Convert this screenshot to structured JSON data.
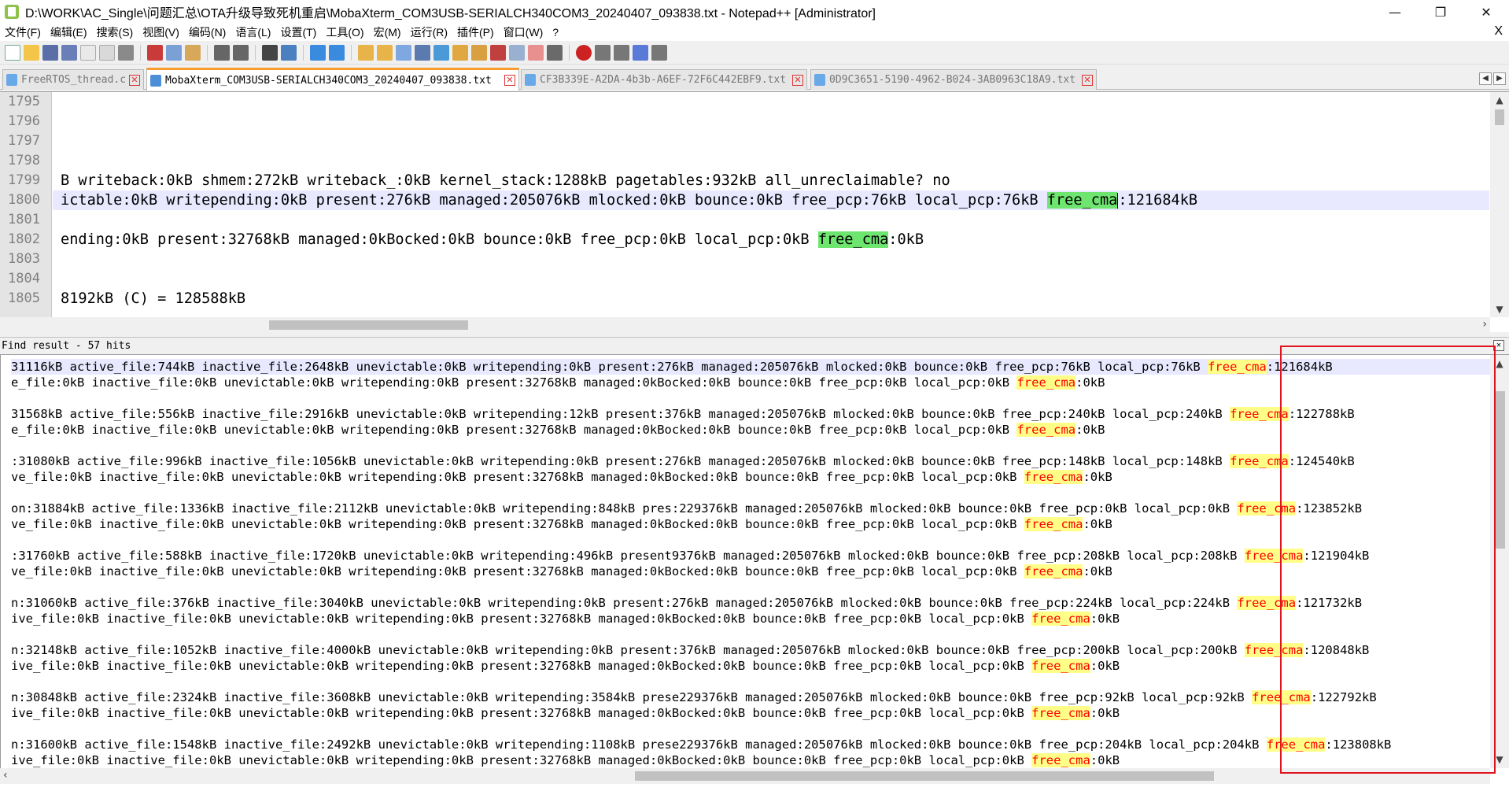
{
  "window": {
    "title": "D:\\WORK\\AC_Single\\问题汇总\\OTA升级导致死机重启\\MobaXterm_COM3USB-SERIALCH340COM3_20240407_093838.txt - Notepad++ [Administrator]",
    "minimize": "—",
    "maximize": "❐",
    "close": "✕"
  },
  "menu": {
    "items": [
      "文件(F)",
      "编辑(E)",
      "搜索(S)",
      "视图(V)",
      "编码(N)",
      "语言(L)",
      "设置(T)",
      "工具(O)",
      "宏(M)",
      "运行(R)",
      "插件(P)",
      "窗口(W)",
      "?"
    ],
    "close": "X"
  },
  "tabs": [
    {
      "label": "FreeRTOS_thread.c",
      "active": false
    },
    {
      "label": "MobaXterm_COM3USB-SERIALCH340COM3_20240407_093838.txt",
      "active": true
    },
    {
      "label": "CF3B339E-A2DA-4b3b-A6EF-72F6C442EBF9.txt",
      "active": false
    },
    {
      "label": "0D9C3651-5190-4962-B024-3AB0963C18A9.txt",
      "active": false
    }
  ],
  "editor": {
    "line_numbers": [
      "1795",
      "1796",
      "1797",
      "1798",
      "1799",
      "1800",
      "1801",
      "1802",
      "1803",
      "1804",
      "1805"
    ],
    "lines": [
      "",
      "",
      "",
      "",
      "B writeback:0kB shmem:272kB writeback_:0kB kernel_stack:1288kB pagetables:932kB all_unreclaimable? no",
      {
        "pre": "ictable:0kB writepending:0kB present:276kB managed:205076kB mlocked:0kB bounce:0kB free_pcp:76kB local_pcp:76kB ",
        "hl": "free_cma",
        "post": ":121684kB"
      },
      "",
      {
        "pre": "ending:0kB present:32768kB managed:0kBocked:0kB bounce:0kB free_pcp:0kB local_pcp:0kB ",
        "hl": "free_cma",
        "post": ":0kB"
      },
      "",
      "",
      "8192kB (C) = 128588kB"
    ]
  },
  "find": {
    "header": "Find result - 57 hits",
    "close": "✕",
    "lines": [
      {
        "pre": "31116kB active_file:744kB inactive_file:2648kB unevictable:0kB writepending:0kB present:276kB managed:205076kB mlocked:0kB bounce:0kB free_pcp:76kB local_pcp:76kB ",
        "hit": "free_cma",
        "post": ":121684kB"
      },
      {
        "pre": "e_file:0kB inactive_file:0kB unevictable:0kB writepending:0kB present:32768kB managed:0kBocked:0kB bounce:0kB free_pcp:0kB local_pcp:0kB ",
        "hit": "free_cma",
        "post": ":0kB"
      },
      null,
      {
        "pre": "31568kB active_file:556kB inactive_file:2916kB unevictable:0kB writepending:12kB present:376kB managed:205076kB mlocked:0kB bounce:0kB free_pcp:240kB local_pcp:240kB ",
        "hit": "free_cma",
        "post": ":122788kB"
      },
      {
        "pre": "e_file:0kB inactive_file:0kB unevictable:0kB writepending:0kB present:32768kB managed:0kBocked:0kB bounce:0kB free_pcp:0kB local_pcp:0kB ",
        "hit": "free_cma",
        "post": ":0kB"
      },
      null,
      {
        "pre": ":31080kB active_file:996kB inactive_file:1056kB unevictable:0kB writepending:0kB present:276kB managed:205076kB mlocked:0kB bounce:0kB free_pcp:148kB local_pcp:148kB ",
        "hit": "free_cma",
        "post": ":124540kB"
      },
      {
        "pre": "ve_file:0kB inactive_file:0kB unevictable:0kB writepending:0kB present:32768kB managed:0kBocked:0kB bounce:0kB free_pcp:0kB local_pcp:0kB ",
        "hit": "free_cma",
        "post": ":0kB"
      },
      null,
      {
        "pre": "on:31884kB active_file:1336kB inactive_file:2112kB unevictable:0kB writepending:848kB pres:229376kB managed:205076kB mlocked:0kB bounce:0kB free_pcp:0kB local_pcp:0kB ",
        "hit": "free_cma",
        "post": ":123852kB"
      },
      {
        "pre": "ve_file:0kB inactive_file:0kB unevictable:0kB writepending:0kB present:32768kB managed:0kBocked:0kB bounce:0kB free_pcp:0kB local_pcp:0kB ",
        "hit": "free_cma",
        "post": ":0kB"
      },
      null,
      {
        "pre": ":31760kB active_file:588kB inactive_file:1720kB unevictable:0kB writepending:496kB present9376kB managed:205076kB mlocked:0kB bounce:0kB free_pcp:208kB local_pcp:208kB ",
        "hit": "free_cma",
        "post": ":121904kB"
      },
      {
        "pre": "ve_file:0kB inactive_file:0kB unevictable:0kB writepending:0kB present:32768kB managed:0kBocked:0kB bounce:0kB free_pcp:0kB local_pcp:0kB ",
        "hit": "free_cma",
        "post": ":0kB"
      },
      null,
      {
        "pre": "n:31060kB active_file:376kB inactive_file:3040kB unevictable:0kB writepending:0kB present:276kB managed:205076kB mlocked:0kB bounce:0kB free_pcp:224kB local_pcp:224kB ",
        "hit": "free_cma",
        "post": ":121732kB"
      },
      {
        "pre": "ive_file:0kB inactive_file:0kB unevictable:0kB writepending:0kB present:32768kB managed:0kBocked:0kB bounce:0kB free_pcp:0kB local_pcp:0kB ",
        "hit": "free_cma",
        "post": ":0kB"
      },
      null,
      {
        "pre": "n:32148kB active_file:1052kB inactive_file:4000kB unevictable:0kB writepending:0kB present:376kB managed:205076kB mlocked:0kB bounce:0kB free_pcp:200kB local_pcp:200kB ",
        "hit": "free_cma",
        "post": ":120848kB"
      },
      {
        "pre": "ive_file:0kB inactive_file:0kB unevictable:0kB writepending:0kB present:32768kB managed:0kBocked:0kB bounce:0kB free_pcp:0kB local_pcp:0kB ",
        "hit": "free_cma",
        "post": ":0kB"
      },
      null,
      {
        "pre": "n:30848kB active_file:2324kB inactive_file:3608kB unevictable:0kB writepending:3584kB prese229376kB managed:205076kB mlocked:0kB bounce:0kB free_pcp:92kB local_pcp:92kB ",
        "hit": "free_cma",
        "post": ":122792kB"
      },
      {
        "pre": "ive_file:0kB inactive_file:0kB unevictable:0kB writepending:0kB present:32768kB managed:0kBocked:0kB bounce:0kB free_pcp:0kB local_pcp:0kB ",
        "hit": "free_cma",
        "post": ":0kB"
      },
      null,
      {
        "pre": "n:31600kB active_file:1548kB inactive_file:2492kB unevictable:0kB writepending:1108kB prese229376kB managed:205076kB mlocked:0kB bounce:0kB free_pcp:204kB local_pcp:204kB ",
        "hit": "free_cma",
        "post": ":123808kB"
      },
      {
        "pre": "ive_file:0kB inactive_file:0kB unevictable:0kB writepending:0kB present:32768kB managed:0kBocked:0kB bounce:0kB free_pcp:0kB local_pcp:0kB ",
        "hit": "free_cma",
        "post": ":0kB"
      }
    ]
  },
  "colors": {
    "accent_tab": "#fa9b2e",
    "highlight_green": "#6ee56e",
    "hit_background": "#ffff88",
    "hit_text": "#ff0000",
    "annotation_box": "#e0141e"
  }
}
